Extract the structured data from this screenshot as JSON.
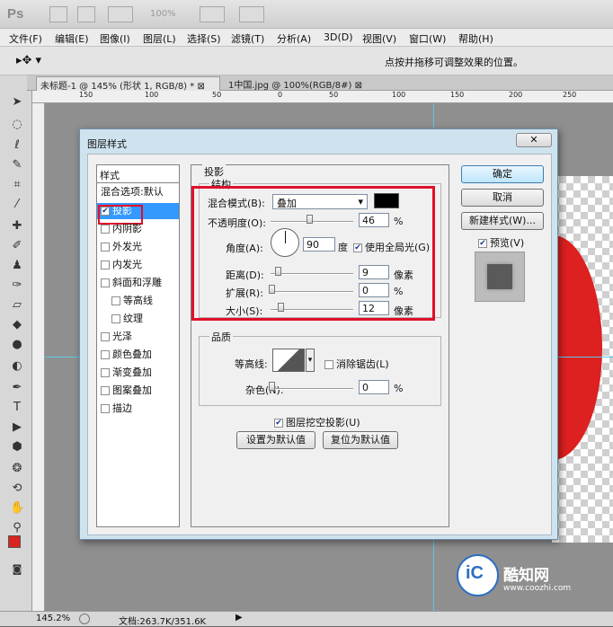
{
  "app": {
    "logo": "Ps",
    "zoom_display": "100%"
  },
  "menu": [
    "文件(F)",
    "编辑(E)",
    "图像(I)",
    "图层(L)",
    "选择(S)",
    "滤镜(T)",
    "分析(A)",
    "3D(D)",
    "视图(V)",
    "窗口(W)",
    "帮助(H)"
  ],
  "options_bar": {
    "hint": "点按并拖移可调整效果的位置。"
  },
  "tabs": [
    {
      "label": "未标题-1 @ 145% (形状 1, RGB/8) *",
      "close": "⊠"
    },
    {
      "label": "1中国.jpg @ 100%(RGB/8#)",
      "close": "⊠"
    }
  ],
  "ruler": {
    "top": [
      "150",
      "100",
      "50",
      "0",
      "50",
      "100",
      "150",
      "200",
      "250"
    ]
  },
  "status": {
    "zoom": "145.2%",
    "doc": "文档:263.7K/351.6K"
  },
  "dialog": {
    "title": "图层样式",
    "close": "✕",
    "styles_header": "样式",
    "styles": [
      {
        "label": "混合选项:默认",
        "checkbox": false,
        "indent": false
      },
      {
        "label": "投影",
        "checkbox": true,
        "checked": true,
        "selected": true,
        "indent": false
      },
      {
        "label": "内阴影",
        "checkbox": true,
        "checked": false,
        "indent": false
      },
      {
        "label": "外发光",
        "checkbox": true,
        "checked": false,
        "indent": false
      },
      {
        "label": "内发光",
        "checkbox": true,
        "checked": false,
        "indent": false
      },
      {
        "label": "斜面和浮雕",
        "checkbox": true,
        "checked": false,
        "indent": false
      },
      {
        "label": "等高线",
        "checkbox": true,
        "checked": false,
        "indent": true
      },
      {
        "label": "纹理",
        "checkbox": true,
        "checked": false,
        "indent": true
      },
      {
        "label": "光泽",
        "checkbox": true,
        "checked": false,
        "indent": false
      },
      {
        "label": "颜色叠加",
        "checkbox": true,
        "checked": false,
        "indent": false
      },
      {
        "label": "渐变叠加",
        "checkbox": true,
        "checked": false,
        "indent": false
      },
      {
        "label": "图案叠加",
        "checkbox": true,
        "checked": false,
        "indent": false
      },
      {
        "label": "描边",
        "checkbox": true,
        "checked": false,
        "indent": false
      }
    ],
    "section_title": "投影",
    "structure": {
      "title": "结构",
      "blend_mode_label": "混合模式(B):",
      "blend_mode_value": "叠加",
      "blend_color": "#000000",
      "opacity_label": "不透明度(O):",
      "opacity_value": "46",
      "opacity_unit": "%",
      "angle_label": "角度(A):",
      "angle_value": "90",
      "angle_unit": "度",
      "global_light_label": "使用全局光(G)",
      "global_light_checked": true,
      "distance_label": "距离(D):",
      "distance_value": "9",
      "distance_unit": "像素",
      "spread_label": "扩展(R):",
      "spread_value": "0",
      "spread_unit": "%",
      "size_label": "大小(S):",
      "size_value": "12",
      "size_unit": "像素"
    },
    "quality": {
      "title": "品质",
      "contour_label": "等高线:",
      "antialias_label": "消除锯齿(L)",
      "antialias_checked": false,
      "noise_label": "杂色(N):",
      "noise_value": "0",
      "noise_unit": "%"
    },
    "knockout_label": "图层挖空投影(U)",
    "knockout_checked": true,
    "set_default_button": "设置为默认值",
    "reset_default_button": "复位为默认值",
    "ok_button": "确定",
    "cancel_button": "取消",
    "new_style_button": "新建样式(W)...",
    "preview_label": "预览(V)",
    "preview_checked": true
  },
  "watermark": {
    "text": "酷知网",
    "url": "www.coozhi.com"
  },
  "colors": {
    "highlight_red": "#e0102a",
    "selection_blue": "#3399ff",
    "circle_red": "#dd2020"
  }
}
